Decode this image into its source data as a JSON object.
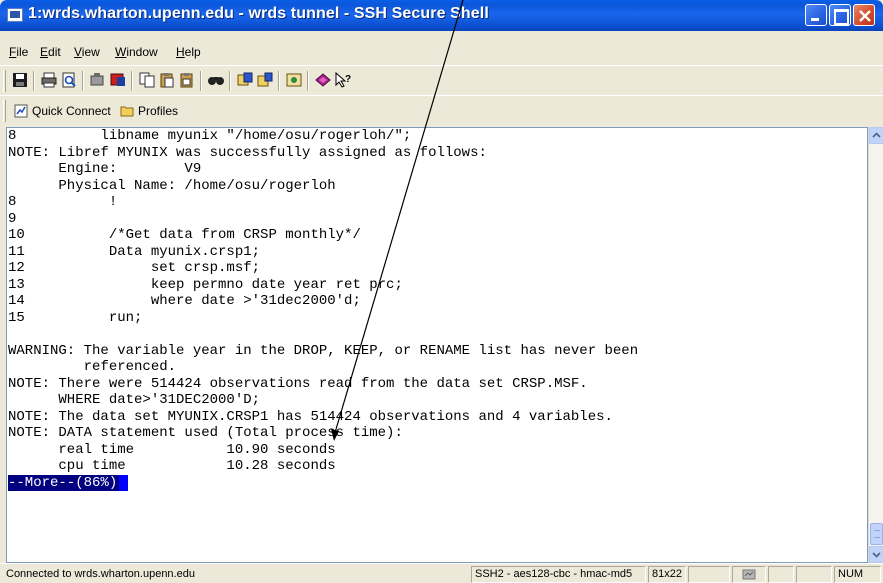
{
  "window": {
    "title": "1:wrds.wharton.upenn.edu - wrds tunnel - SSH Secure Shell"
  },
  "menu": {
    "items": [
      {
        "label": "File",
        "underline": "F",
        "rest": "ile"
      },
      {
        "label": "Edit",
        "underline": "E",
        "rest": "dit"
      },
      {
        "label": "View",
        "underline": "V",
        "rest": "iew"
      },
      {
        "label": "Window",
        "underline": "W",
        "rest": "indow"
      },
      {
        "label": "Help",
        "underline": "H",
        "rest": "elp"
      }
    ]
  },
  "toolbar": {
    "icons": [
      "save-icon",
      "print-icon",
      "print-preview-icon",
      "disconnect-icon",
      "new-terminal-icon",
      "copy-icon",
      "paste-icon",
      "paste-alt-icon",
      "find-icon",
      "new-file-transfer-icon",
      "file-transfer-icon",
      "settings-icon",
      "help-book-icon",
      "context-help-icon"
    ],
    "quick_connect_label": "Quick Connect",
    "profiles_label": "Profiles"
  },
  "terminal": {
    "lines": [
      "8          libname myunix \"/home/osu/rogerloh/\";",
      "NOTE: Libref MYUNIX was successfully assigned as follows:",
      "      Engine:        V9",
      "      Physical Name: /home/osu/rogerloh",
      "8           !",
      "9",
      "10          /*Get data from CRSP monthly*/",
      "11          Data myunix.crsp1;",
      "12               set crsp.msf;",
      "13               keep permno date year ret prc;",
      "14               where date >'31dec2000'd;",
      "15          run;",
      "",
      "WARNING: The variable year in the DROP, KEEP, or RENAME list has never been",
      "         referenced.",
      "NOTE: There were 514424 observations read from the data set CRSP.MSF.",
      "      WHERE date>'31DEC2000'D;",
      "NOTE: The data set MYUNIX.CRSP1 has 514424 observations and 4 variables.",
      "NOTE: DATA statement used (Total process time):",
      "      real time           10.90 seconds",
      "      cpu time            10.28 seconds"
    ],
    "more_prompt": "--More--(86%)"
  },
  "status": {
    "connection": "Connected to wrds.wharton.upenn.edu",
    "cipher": "SSH2 - aes128-cbc - hmac-md5",
    "size": "81x22",
    "num": "NUM"
  },
  "colors": {
    "title_bar": "#0b56d9",
    "more_prompt_bg": "#000080",
    "cursor": "#0000ff"
  }
}
